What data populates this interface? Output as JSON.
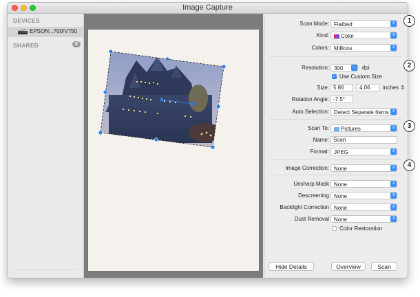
{
  "window": {
    "title": "Image Capture"
  },
  "sidebar": {
    "devices_header": "DEVICES",
    "device_name": "EPSON...700/V750",
    "shared_header": "SHARED",
    "shared_count": "0"
  },
  "settings": {
    "scan_mode": {
      "label": "Scan Mode:",
      "value": "Flatbed"
    },
    "kind": {
      "label": "Kind:",
      "value": "Color"
    },
    "colors": {
      "label": "Colors:",
      "value": "Millions"
    },
    "resolution": {
      "label": "Resolution:",
      "value": "300",
      "unit": "dpi"
    },
    "custom_size": {
      "label": "Use Custom Size",
      "checked": true
    },
    "size": {
      "label": "Size:",
      "width": "5.86",
      "height": "4.06",
      "unit": "inches"
    },
    "rotation": {
      "label": "Rotation Angle:",
      "value": "-7.5°"
    },
    "auto_selection": {
      "label": "Auto Selection:",
      "value": "Detect Separate Items"
    },
    "scan_to": {
      "label": "Scan To:",
      "value": "Pictures"
    },
    "name": {
      "label": "Name:",
      "value": "Scan"
    },
    "format": {
      "label": "Format:",
      "value": "JPEG"
    },
    "image_correction": {
      "label": "Image Correction:",
      "value": "None"
    },
    "unsharp_mask": {
      "label": "Unsharp Mask",
      "value": "None"
    },
    "descreening": {
      "label": "Descreening",
      "value": "None"
    },
    "backlight": {
      "label": "Backlight Correction",
      "value": "None"
    },
    "dust_removal": {
      "label": "Dust Removal",
      "value": "None"
    },
    "color_restoration": {
      "label": "Color Restoration",
      "checked": false
    }
  },
  "buttons": {
    "hide_details": "Hide Details",
    "overview": "Overview",
    "scan": "Scan"
  },
  "callouts": [
    "1",
    "2",
    "3",
    "4"
  ],
  "colors": {
    "accent": "#3b8ff5",
    "preview_bg": "#7c7c7c",
    "selection_handle": "#2f7ce0"
  }
}
